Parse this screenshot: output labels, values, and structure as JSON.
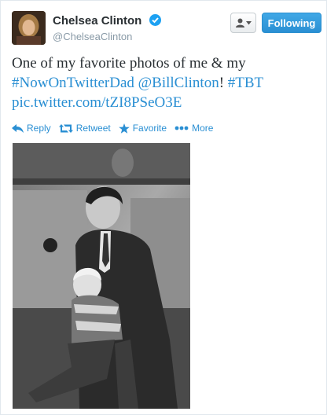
{
  "author": {
    "name": "Chelsea Clinton",
    "handle": "@ChelseaClinton"
  },
  "header": {
    "follow_label": "Following"
  },
  "tweet": {
    "text_plain": "One of my favorite photos of me & my ",
    "hashtag_dad": "#NowOnTwitterDad",
    "mention": "@BillClinton",
    "bang": "!",
    "hashtag_tbt": "#TBT",
    "link": "pic.twitter.com/tZI8PSeO3E"
  },
  "actions": {
    "reply": "Reply",
    "retweet": "Retweet",
    "favorite": "Favorite",
    "more": "More"
  },
  "colors": {
    "link": "#2a8fd3",
    "follow_button": "#2a8fd3",
    "verified_badge": "#1da1f2"
  },
  "icons": [
    "verified-icon",
    "user-icon",
    "chevron-down-icon",
    "reply-icon",
    "retweet-icon",
    "star-icon",
    "more-icon"
  ]
}
